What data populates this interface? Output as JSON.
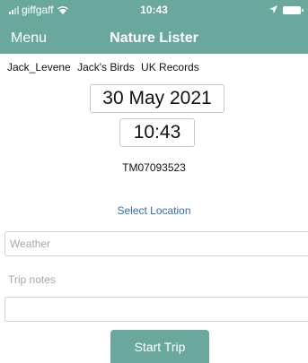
{
  "status_bar": {
    "carrier": "giffgaff",
    "time": "10:43",
    "icons": [
      "signal-icon",
      "wifi-icon",
      "location-arrow-icon",
      "battery-icon"
    ]
  },
  "nav": {
    "menu_label": "Menu",
    "title": "Nature Lister"
  },
  "tabs": [
    {
      "label": "Jack_Levene"
    },
    {
      "label": "Jack's Birds"
    },
    {
      "label": "UK Records"
    }
  ],
  "trip": {
    "date": "30 May 2021",
    "time": "10:43",
    "grid_ref": "TM07093523",
    "select_location": "Select Location",
    "weather_placeholder": "Weather",
    "notes_label": "Trip notes",
    "notes_value": "",
    "start_label": "Start Trip"
  },
  "colors": {
    "accent": "#6aa89d",
    "link": "#2b6fb7"
  }
}
